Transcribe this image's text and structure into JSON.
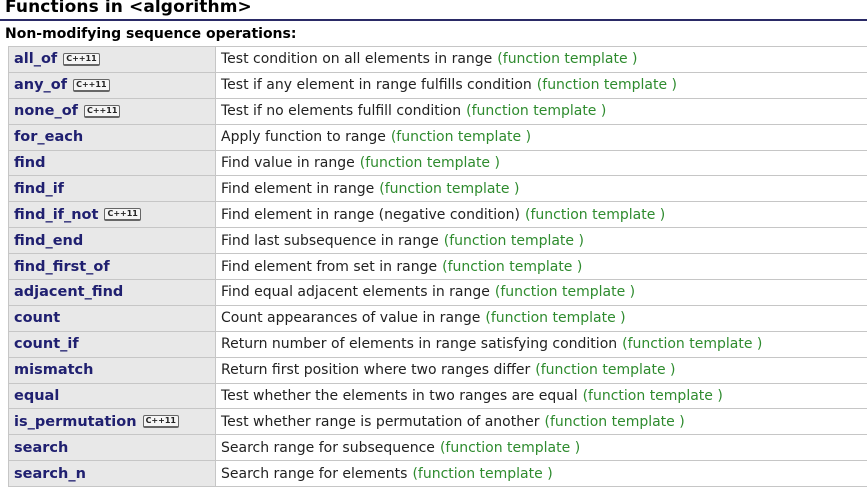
{
  "page": {
    "title": "Functions in <algorithm>",
    "section": "Non-modifying sequence operations:",
    "cxx11_badge": "C++11",
    "function_type_label": "(function template )"
  },
  "colors": {
    "name_link": "#202070",
    "function_type": "#2e8b2e",
    "name_cell_bg": "#e8e8e8",
    "title_rule": "#2a2a66"
  },
  "rows": [
    {
      "name": "all_of",
      "cxx11": true,
      "desc": "Test condition on all elements in range",
      "type": "(function template )"
    },
    {
      "name": "any_of",
      "cxx11": true,
      "desc": "Test if any element in range fulfills condition",
      "type": "(function template )"
    },
    {
      "name": "none_of",
      "cxx11": true,
      "desc": "Test if no elements fulfill condition",
      "type": "(function template )"
    },
    {
      "name": "for_each",
      "cxx11": false,
      "desc": "Apply function to range",
      "type": "(function template )"
    },
    {
      "name": "find",
      "cxx11": false,
      "desc": "Find value in range",
      "type": "(function template )"
    },
    {
      "name": "find_if",
      "cxx11": false,
      "desc": "Find element in range",
      "type": "(function template )"
    },
    {
      "name": "find_if_not",
      "cxx11": true,
      "desc": "Find element in range (negative condition)",
      "type": "(function template )"
    },
    {
      "name": "find_end",
      "cxx11": false,
      "desc": "Find last subsequence in range",
      "type": "(function template )"
    },
    {
      "name": "find_first_of",
      "cxx11": false,
      "desc": "Find element from set in range",
      "type": "(function template )"
    },
    {
      "name": "adjacent_find",
      "cxx11": false,
      "desc": "Find equal adjacent elements in range",
      "type": "(function template )"
    },
    {
      "name": "count",
      "cxx11": false,
      "desc": "Count appearances of value in range",
      "type": "(function template )"
    },
    {
      "name": "count_if",
      "cxx11": false,
      "desc": "Return number of elements in range satisfying condition",
      "type": "(function template )"
    },
    {
      "name": "mismatch",
      "cxx11": false,
      "desc": "Return first position where two ranges differ",
      "type": "(function template )"
    },
    {
      "name": "equal",
      "cxx11": false,
      "desc": "Test whether the elements in two ranges are equal",
      "type": "(function template )"
    },
    {
      "name": "is_permutation",
      "cxx11": true,
      "desc": "Test whether range is permutation of another",
      "type": "(function template )"
    },
    {
      "name": "search",
      "cxx11": false,
      "desc": "Search range for subsequence",
      "type": "(function template )"
    },
    {
      "name": "search_n",
      "cxx11": false,
      "desc": "Search range for elements",
      "type": "(function template )"
    }
  ]
}
